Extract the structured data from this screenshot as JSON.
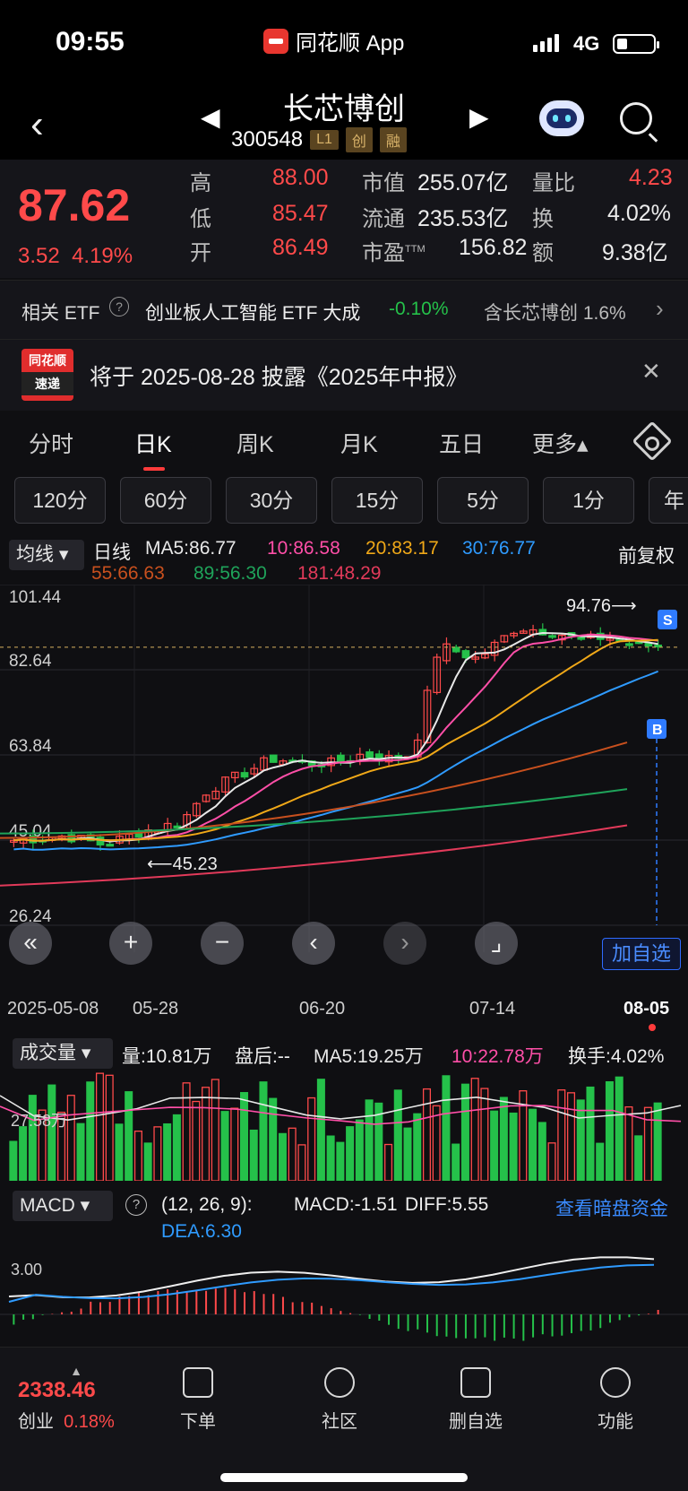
{
  "status": {
    "time": "09:55",
    "app": "同花顺 App",
    "network": "4G"
  },
  "header": {
    "name": "长芯博创",
    "code": "300548",
    "tags": [
      "L1",
      "创",
      "融"
    ]
  },
  "quote": {
    "price": "87.62",
    "change": "3.52",
    "change_pct": "4.19%",
    "high_label": "高",
    "high": "88.00",
    "low_label": "低",
    "low": "85.47",
    "open_label": "开",
    "open": "86.49",
    "mcap_label": "市值",
    "mcap": "255.07亿",
    "float_label": "流通",
    "float": "235.53亿",
    "pe_label": "市盈",
    "pe_sup": "TTM",
    "pe": "156.82",
    "volratio_label": "量比",
    "volratio": "4.23",
    "turnover_label": "换",
    "turnover": "4.02%",
    "amount_label": "额",
    "amount": "9.38亿"
  },
  "etf": {
    "label": "相关 ETF",
    "name": "创业板人工智能 ETF 大成",
    "change": "-0.10%",
    "holding": "含长芯博创  1.6%"
  },
  "banner": {
    "badge_top": "同花顺",
    "badge_bottom": "速递",
    "text": "将于 2025-08-28 披露《2025年中报》"
  },
  "tabs": [
    "分时",
    "日K",
    "周K",
    "月K",
    "五日",
    "更多▴"
  ],
  "intervals": [
    "120分",
    "60分",
    "30分",
    "15分",
    "5分",
    "1分",
    "年"
  ],
  "ma_legend": {
    "selector": "均线",
    "prefix": "日线",
    "ma5": "MA5:86.77",
    "ma10": "10:86.58",
    "ma20": "20:83.17",
    "ma30": "30:76.77",
    "ma55": "55:66.63",
    "ma89": "89:56.30",
    "ma181": "181:48.29",
    "adjust": "前复权"
  },
  "colors": {
    "ma5": "#e8e8e8",
    "ma10": "#ff4fa8",
    "ma20": "#f0a818",
    "ma30": "#2f9bff",
    "ma55": "#c8501e",
    "ma89": "#1fa35a",
    "ma181": "#e23a5a",
    "up": "#ff4a4a",
    "down": "#25c14a"
  },
  "chart_data": {
    "type": "candlestick",
    "y_ticks": [
      "101.44",
      "82.64",
      "63.84",
      "45.04",
      "26.24"
    ],
    "x_ticks": [
      "2025-05-08",
      "05-28",
      "06-20",
      "07-14",
      "08-05"
    ],
    "high_marker": "94.76",
    "low_marker": "45.23",
    "signals": [
      "S",
      "B"
    ],
    "add_watch": "加自选"
  },
  "volume": {
    "selector": "成交量",
    "vol": "量:10.81万",
    "after": "盘后:--",
    "ma5": "MA5:19.25万",
    "ma10": "10:22.78万",
    "turnover": "换手:4.02%",
    "axis": "27.58万"
  },
  "macd": {
    "selector": "MACD",
    "params": "(12, 26, 9):",
    "macd": "MACD:-1.51",
    "diff": "DIFF:5.55",
    "dea": "DEA:6.30",
    "link": "查看暗盘资金",
    "axis": "3.00"
  },
  "bottom": {
    "index_value": "2338.46",
    "index_name": "创业",
    "index_change": "0.18%",
    "items": [
      "下单",
      "社区",
      "删自选",
      "功能"
    ]
  }
}
